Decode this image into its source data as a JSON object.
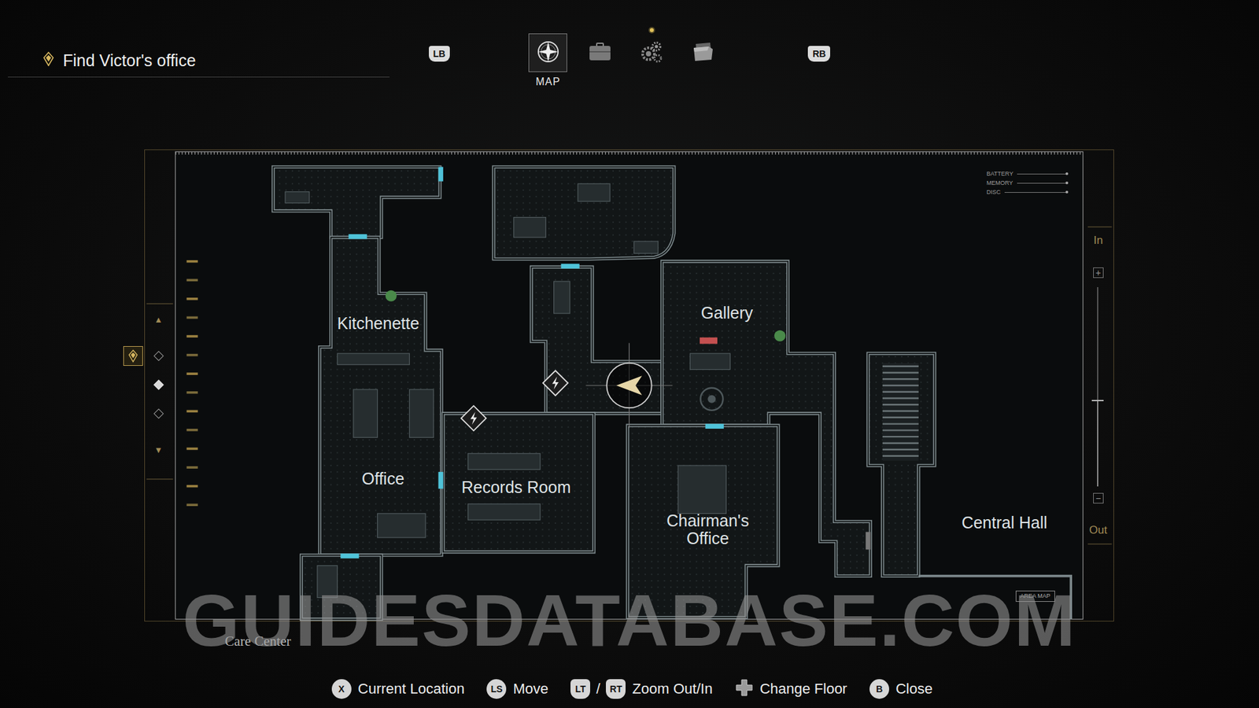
{
  "objective": {
    "text": "Find Victor's office"
  },
  "tabs": {
    "left_button": "LB",
    "right_button": "RB",
    "items": [
      {
        "kind": "map",
        "label": "MAP",
        "selected": true,
        "notification": false
      },
      {
        "kind": "inventory",
        "selected": false,
        "notification": false
      },
      {
        "kind": "settings",
        "selected": false,
        "notification": true
      },
      {
        "kind": "files",
        "selected": false,
        "notification": false
      }
    ]
  },
  "floors": {
    "up": "▲",
    "down": "▼",
    "items": [
      {
        "selected": false,
        "current": true
      },
      {
        "selected": true,
        "current": false
      },
      {
        "selected": false,
        "current": false
      }
    ]
  },
  "map": {
    "rooms": [
      "Kitchenette",
      "Office",
      "Records Room",
      "Gallery",
      "Chairman's Office",
      "Central Hall"
    ],
    "legend": [
      "BATTERY",
      "MEMORY",
      "DISC"
    ],
    "zoom": {
      "in": "In",
      "out": "Out",
      "plus": "+",
      "minus": "−",
      "level": 0.43
    },
    "area_map": "AREA MAP"
  },
  "area_name": "Care Center",
  "watermark": "GUIDESDATABASE.COM",
  "controls": [
    {
      "kind": "button",
      "keys": [
        "X"
      ],
      "label": "Current Location"
    },
    {
      "kind": "button",
      "keys": [
        "LS"
      ],
      "label": "Move"
    },
    {
      "kind": "trigger",
      "keys": [
        "LT",
        "RT"
      ],
      "separator": "/",
      "label": "Zoom Out/In"
    },
    {
      "kind": "dpad",
      "keys": [],
      "label": "Change Floor"
    },
    {
      "kind": "button",
      "keys": [
        "B"
      ],
      "label": "Close"
    }
  ]
}
